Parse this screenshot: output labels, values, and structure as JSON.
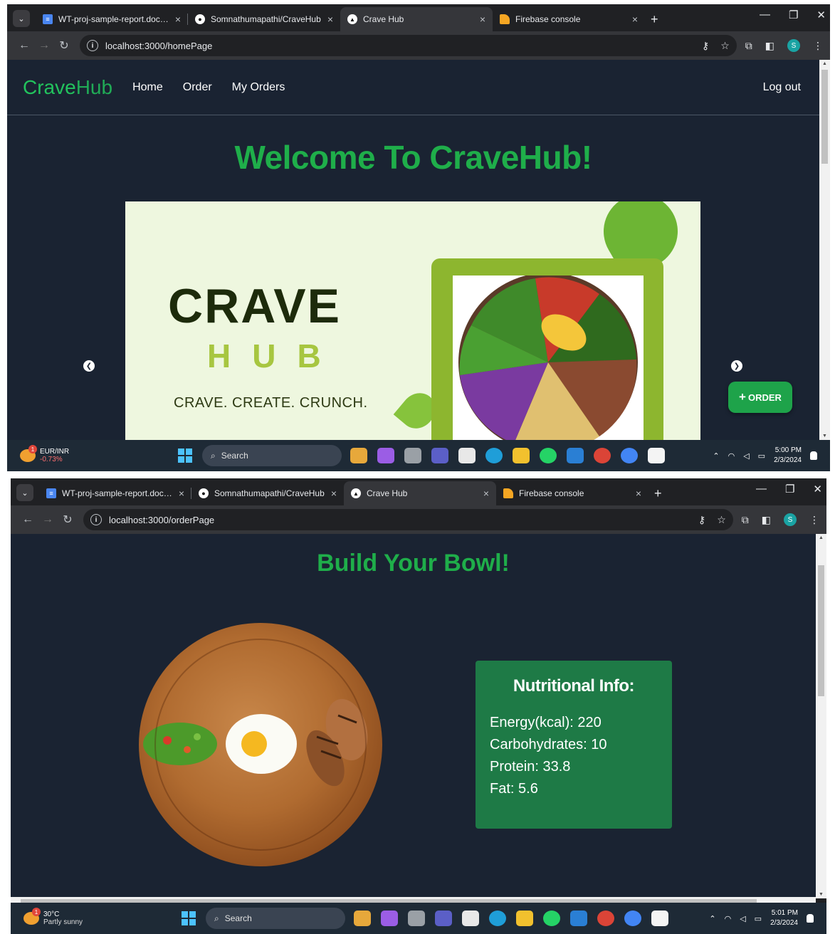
{
  "browser1": {
    "tabs": [
      {
        "title": "WT-proj-sample-report.docx - ("
      },
      {
        "title": "Somnathumapathi/CraveHub"
      },
      {
        "title": "Crave Hub"
      },
      {
        "title": "Firebase console"
      }
    ],
    "url": "localhost:3000/homePage"
  },
  "home": {
    "brand_crave": "Crave",
    "brand_hub": "Hub",
    "nav": [
      "Home",
      "Order",
      "My Orders"
    ],
    "logout": "Log out",
    "welcome": "Welcome To CraveHub!",
    "banner_title": "CRAVE",
    "banner_sub": "HUB",
    "banner_tagline": "CRAVE. CREATE. CRUNCH.",
    "order_button": "ORDER"
  },
  "taskbar1": {
    "widget_line1": "EUR/INR",
    "widget_line2": "-0.73%",
    "search": "Search",
    "time": "5:00 PM",
    "date": "2/3/2024"
  },
  "browser2": {
    "tabs": [
      {
        "title": "WT-proj-sample-report.docx - ("
      },
      {
        "title": "Somnathumapathi/CraveHub"
      },
      {
        "title": "Crave Hub"
      },
      {
        "title": "Firebase console"
      }
    ],
    "url": "localhost:3000/orderPage"
  },
  "order": {
    "title": "Build Your Bowl!",
    "nutrition_title": "Nutritional Info:",
    "nutrition": [
      "Energy(kcal): 220",
      "Carbohydrates: 10",
      "Protein: 33.8",
      "Fat: 5.6"
    ]
  },
  "taskbar2": {
    "widget_line1": "30°C",
    "widget_line2": "Partly sunny",
    "search": "Search",
    "time": "5:01 PM",
    "date": "2/3/2024"
  },
  "colors": {
    "accent_green": "#1fae4a",
    "page_bg": "#1a2332",
    "nutrition_bg": "#1e7a46"
  }
}
